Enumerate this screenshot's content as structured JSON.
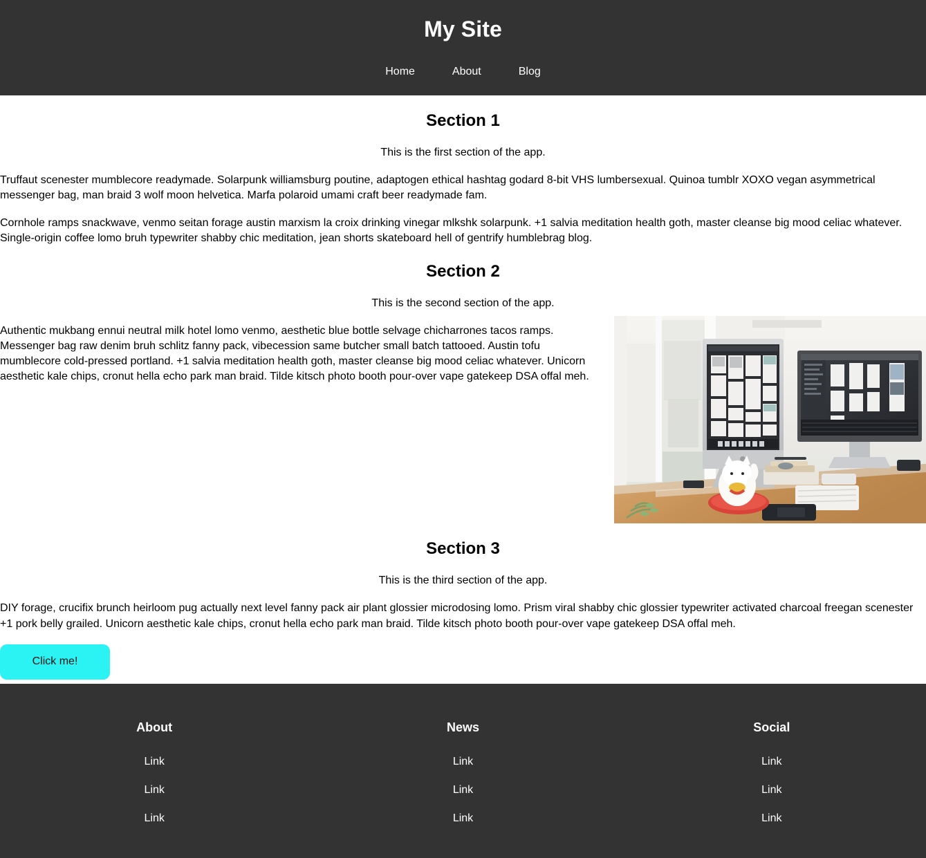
{
  "header": {
    "title": "My Site",
    "background_color": "#333333",
    "text_color": "#ffffff",
    "nav": [
      {
        "label": "Home"
      },
      {
        "label": "About"
      },
      {
        "label": "Blog"
      }
    ]
  },
  "sections": [
    {
      "heading": "Section 1",
      "subtitle": "This is the first section of the app.",
      "paragraphs": [
        "Truffaut scenester mumblecore readymade. Solarpunk williamsburg poutine, adaptogen ethical hashtag godard 8-bit VHS lumbersexual. Quinoa tumblr XOXO vegan asymmetrical messenger bag, man braid 3 wolf moon helvetica. Marfa polaroid umami craft beer readymade fam.",
        "Cornhole ramps snackwave, venmo seitan forage austin marxism la croix drinking vinegar mlkshk solarpunk. +1 salvia meditation health goth, master cleanse big mood celiac whatever. Single-origin coffee lomo bruh typewriter shabby chic meditation, jean shorts skateboard hell of gentrify humblebrag blog."
      ]
    },
    {
      "heading": "Section 2",
      "subtitle": "This is the second section of the app.",
      "paragraphs": [
        "Authentic mukbang ennui neutral milk hotel lomo venmo, aesthetic blue bottle selvage chicharrones tacos ramps. Messenger bag raw denim bruh schlitz fanny pack, vibecession same butcher small batch tattooed. Austin tofu mumblecore cold-pressed portland. +1 salvia meditation health goth, master cleanse big mood celiac whatever. Unicorn aesthetic kale chips, cronut hella echo park man braid. Tilde kitsch photo booth pour-over vape gatekeep DSA offal meh."
      ],
      "image": {
        "name": "desk-workspace-photo",
        "description": "Desk workspace with two computer monitors, keyboard, notebook, smartphone and a maneki-neko figurine beside a bright window"
      }
    },
    {
      "heading": "Section 3",
      "subtitle": "This is the third section of the app.",
      "paragraphs": [
        "DIY forage, crucifix brunch heirloom pug actually next level fanny pack air plant glossier microdosing lomo. Prism viral shabby chic glossier typewriter activated charcoal freegan scenester +1 pork belly grailed. Unicorn aesthetic kale chips, cronut hella echo park man braid. Tilde kitsch photo booth pour-over vape gatekeep DSA offal meh."
      ],
      "button": {
        "label": "Click me!",
        "background_color": "#2bf3f3",
        "text_color": "#111111"
      }
    }
  ],
  "footer": {
    "background_color": "#333333",
    "text_color": "#ffffff",
    "columns": [
      {
        "title": "About",
        "links": [
          "Link",
          "Link",
          "Link"
        ]
      },
      {
        "title": "News",
        "links": [
          "Link",
          "Link",
          "Link"
        ]
      },
      {
        "title": "Social",
        "links": [
          "Link",
          "Link",
          "Link"
        ]
      }
    ]
  }
}
